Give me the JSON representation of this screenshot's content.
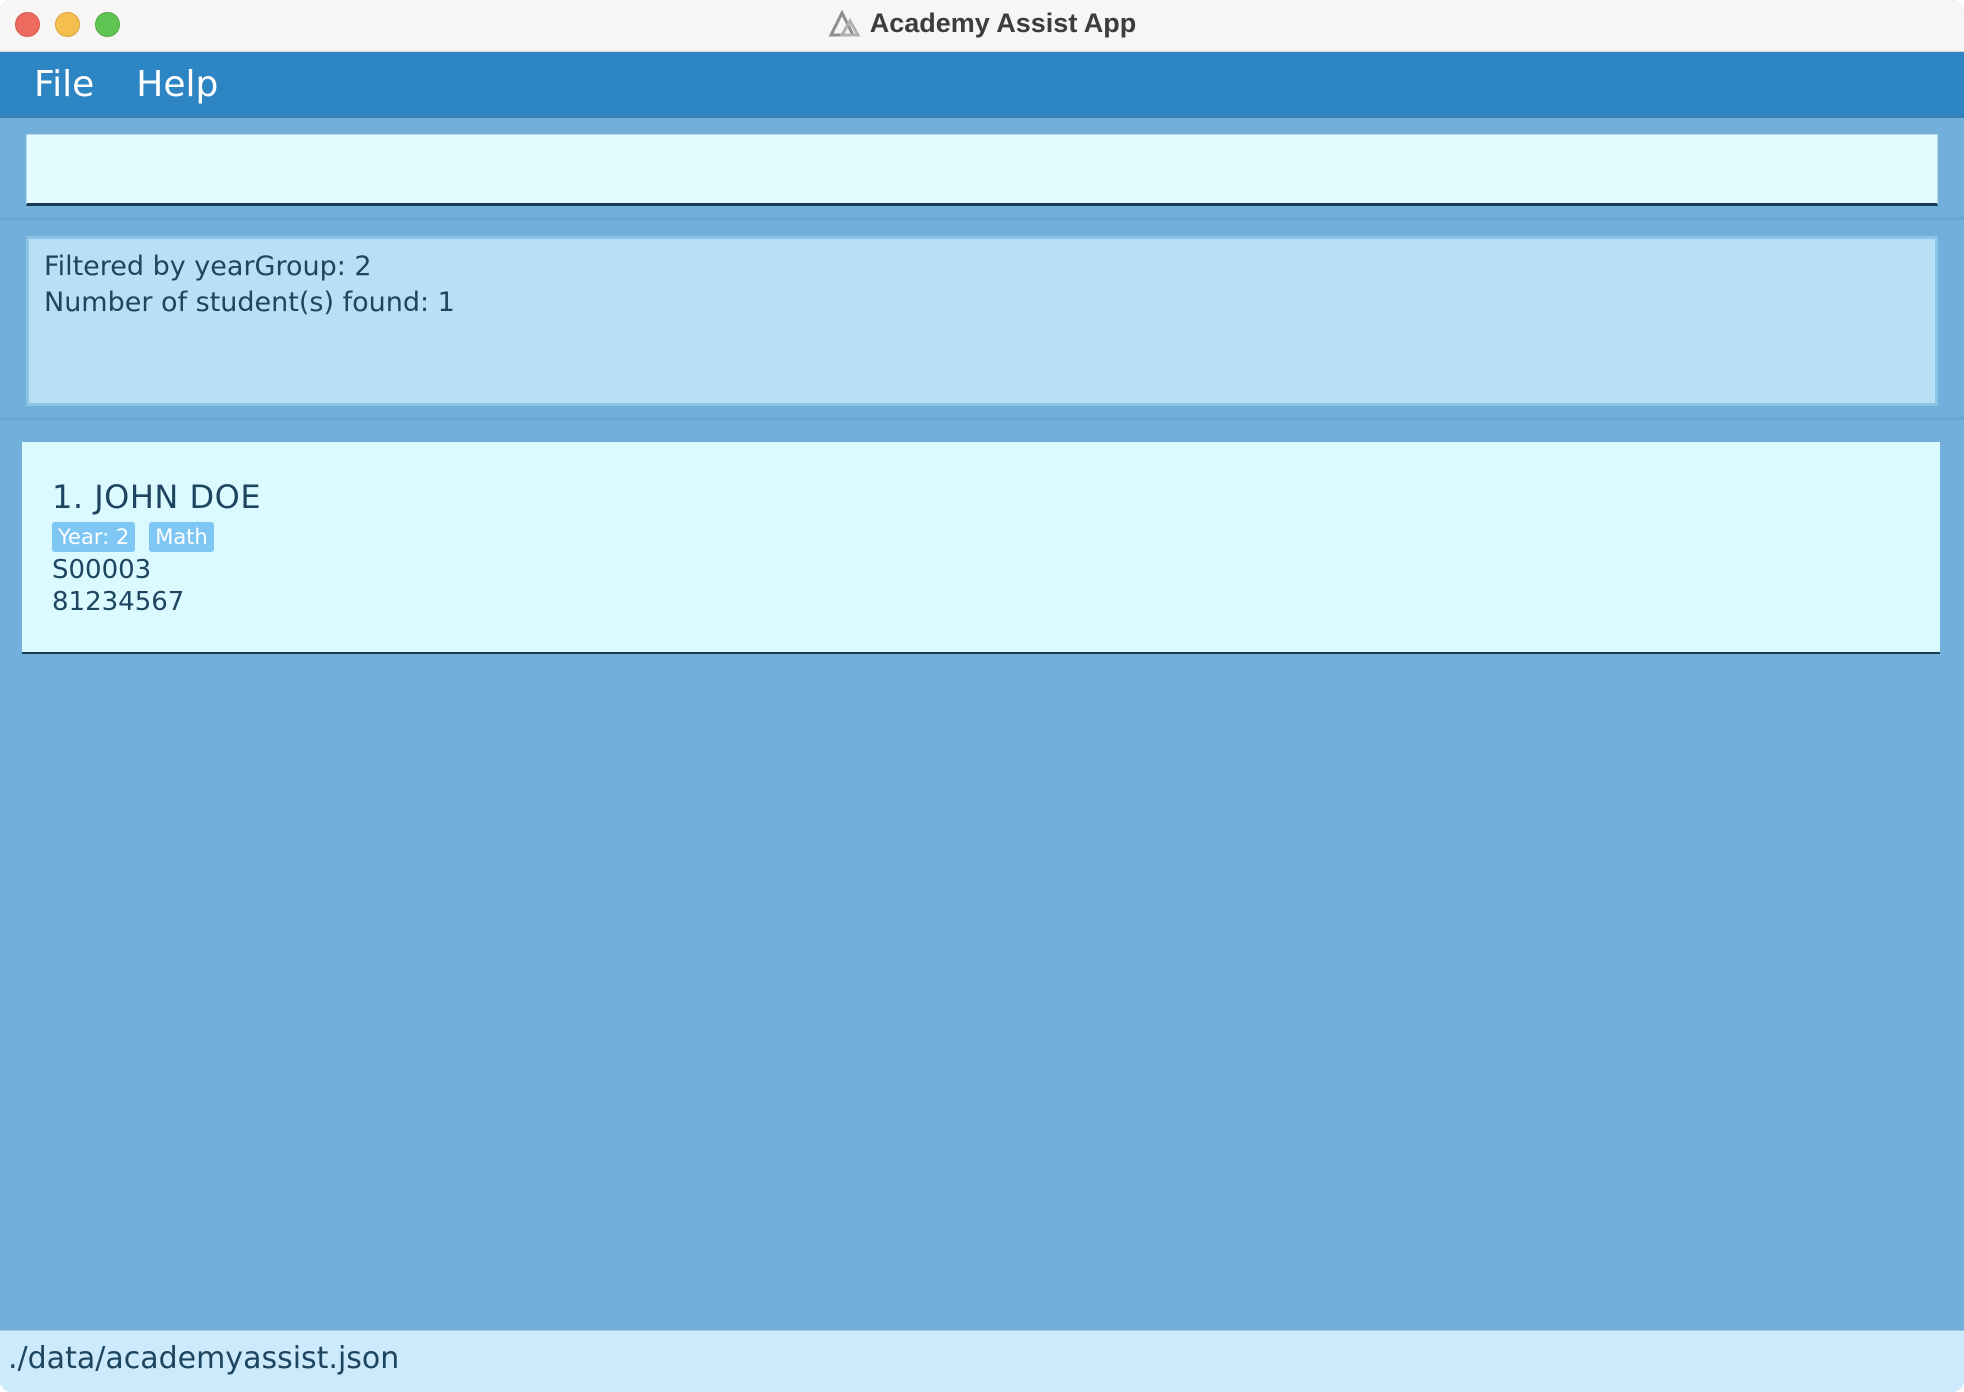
{
  "window": {
    "title": "Academy Assist App"
  },
  "menubar": {
    "items": [
      {
        "label": "File"
      },
      {
        "label": "Help"
      }
    ]
  },
  "command": {
    "value": "",
    "placeholder": ""
  },
  "result": {
    "lines": [
      "Filtered by yearGroup: 2",
      "Number of student(s) found: 1"
    ]
  },
  "students": [
    {
      "heading": "1. JOHN DOE",
      "tags": [
        "Year: 2",
        "Math"
      ],
      "id": "S00003",
      "phone": "81234567"
    }
  ],
  "statusbar": {
    "path": "./data/academyassist.json"
  },
  "colors": {
    "menubar": "#2d85c3",
    "background": "#73afdb",
    "card": "#dbfaff",
    "tag": "#7ec6f3"
  }
}
